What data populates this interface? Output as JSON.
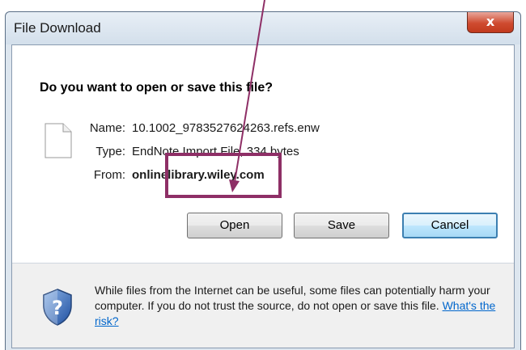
{
  "window": {
    "title": "File Download",
    "close_glyph": "x"
  },
  "dialog": {
    "question": "Do you want to open or save this file?",
    "file": {
      "name_label": "Name:",
      "name_value": "10.1002_9783527624263.refs.enw",
      "type_label": "Type:",
      "type_value": "EndNote Import File, 334 bytes",
      "from_label": "From:",
      "from_value": "onlinelibrary.wiley.com"
    },
    "buttons": {
      "open": "Open",
      "save": "Save",
      "cancel": "Cancel"
    },
    "warning": {
      "text": "While files from the Internet can be useful, some files can potentially harm your computer. If you do not trust the source, do not open or save this file.",
      "link": "What's the risk?"
    }
  },
  "annotation": {
    "highlight_color": "#8e2f66",
    "points_to": "open-button"
  },
  "icons": {
    "file": "file-icon",
    "shield": "shield-icon",
    "close": "close-icon"
  }
}
